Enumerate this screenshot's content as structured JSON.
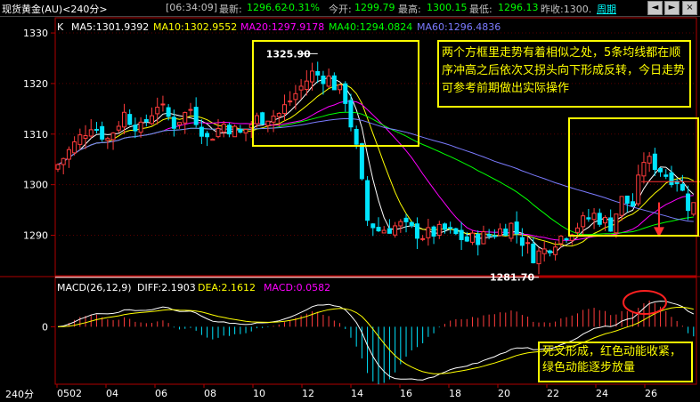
{
  "topbar": {
    "title": "现货黄金(AU)<240分>",
    "time": "[06:34:09]",
    "latest_label": "最新:",
    "latest_value": "1296.62",
    "change": "-0.31%",
    "open_label": "今开:",
    "open_value": "1299.79",
    "high_label": "最高:",
    "high_value": "1300.15",
    "low_label": "最低:",
    "low_value": "1296.13",
    "prev_close": "昨收:1300.",
    "period": "周期",
    "window_buttons": [
      "◄",
      "►",
      "×"
    ]
  },
  "colors": {
    "up": "#ff3c3c",
    "down": "#00e5ff",
    "ma5": "#ffffff",
    "ma10": "#ffff00",
    "ma20": "#ff00ff",
    "ma40": "#00ff00",
    "ma60": "#7b7bff",
    "annotation": "#ffff00"
  },
  "chart_data": {
    "type": "candlestick",
    "price_panel": {
      "ylim": [
        1282,
        1333
      ],
      "yticks": [
        1290,
        1300,
        1310,
        1320,
        1330
      ],
      "label": "K",
      "legend": [
        {
          "key": "ma5",
          "text": "MA5:1301.9392"
        },
        {
          "key": "ma10",
          "text": "MA10:1302.9552"
        },
        {
          "key": "ma20",
          "text": "MA20:1297.9178"
        },
        {
          "key": "ma40",
          "text": "MA40:1294.0824"
        },
        {
          "key": "ma60",
          "text": "MA60:1296.4836"
        }
      ],
      "high_marker": {
        "label": "1325.90",
        "value": 1325.9
      },
      "low_marker": {
        "label": "1281.70",
        "value": 1281.7
      },
      "close_trend": [
        [
          0,
          1304
        ],
        [
          3,
          1308
        ],
        [
          6,
          1312
        ],
        [
          9,
          1309
        ],
        [
          12,
          1314
        ],
        [
          15,
          1311
        ],
        [
          18,
          1316
        ],
        [
          21,
          1312
        ],
        [
          24,
          1315
        ],
        [
          27,
          1309
        ],
        [
          30,
          1312
        ],
        [
          33,
          1310
        ],
        [
          36,
          1313
        ],
        [
          40,
          1314
        ],
        [
          43,
          1318
        ],
        [
          46,
          1322
        ],
        [
          49,
          1321
        ],
        [
          52,
          1317
        ],
        [
          54,
          1307
        ],
        [
          56,
          1293
        ],
        [
          58,
          1291
        ],
        [
          62,
          1292
        ],
        [
          66,
          1290
        ],
        [
          70,
          1291
        ],
        [
          74,
          1289
        ],
        [
          78,
          1290
        ],
        [
          82,
          1292
        ],
        [
          86,
          1286
        ],
        [
          88,
          1287
        ],
        [
          90,
          1289
        ],
        [
          94,
          1292
        ],
        [
          97,
          1294
        ],
        [
          100,
          1292
        ],
        [
          102,
          1297
        ],
        [
          104,
          1296
        ],
        [
          106,
          1305
        ],
        [
          108,
          1304
        ],
        [
          110,
          1302
        ],
        [
          112,
          1301
        ],
        [
          114,
          1296
        ]
      ]
    },
    "macd_panel": {
      "legend": "MACD(26,12,9)",
      "diff": "DIFF:2.1903",
      "dea": "DEA:2.1612",
      "macd": "MACD:0.0582",
      "ylim": [
        -7,
        6
      ],
      "ytick": "0"
    },
    "xaxis": {
      "labels": [
        "0502",
        "04",
        "06",
        "08",
        "10",
        "12",
        "14",
        "16",
        "18",
        "20",
        "22",
        "24",
        "26"
      ],
      "period_label": "240分"
    }
  },
  "annotations": {
    "box1_text": "两个方框里走势有着相似之处，5条均线都在顺序冲高之后依次又拐头向下形成反转，今日走势可参考前期做出实际操作",
    "box2_text": "死叉形成，红色动能收紧，绿色动能逐步放量"
  }
}
